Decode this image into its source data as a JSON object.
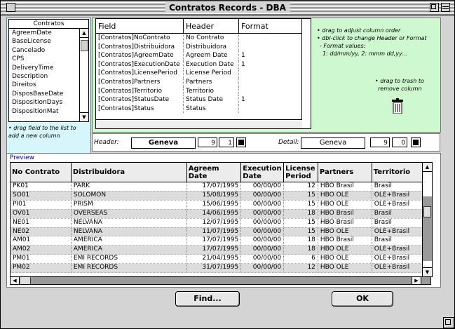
{
  "window": {
    "title": "Contratos Records - DBA"
  },
  "field_list": {
    "header": "Contratos",
    "items": [
      "AgreemDate",
      "BaseLicense",
      "Cancelado",
      "CPS",
      "DeliveryTime",
      "Description",
      "Direitos",
      "DisposBaseDate",
      "DispositionDays",
      "DispositionMat"
    ],
    "hint": "• drag field to the list to add a new column"
  },
  "column_table": {
    "headers": [
      "Field",
      "Header",
      "Format"
    ],
    "rows": [
      [
        "[Contratos]NoContrato",
        "No Contrato",
        ""
      ],
      [
        "[Contratos]Distribuidora",
        "Distribuidora",
        ""
      ],
      [
        "[Contratos]AgreemDate",
        "Agreem Date",
        "1"
      ],
      [
        "[Contratos]ExecutionDate",
        "Execution Date",
        "1"
      ],
      [
        "[Contratos]LicensePeriod",
        "License Period",
        ""
      ],
      [
        "[Contratos]Partners",
        "Partners",
        ""
      ],
      [
        "[Contratos]Territorio",
        "Territorio",
        ""
      ],
      [
        "[Contratos]StatusDate",
        "Status Date",
        "1"
      ],
      [
        "[Contratos]Status",
        "Status",
        ""
      ]
    ]
  },
  "hints": {
    "line1": "• drag to adjust column order",
    "line2": "• dbl-click to change Header or Format",
    "line3": "- Format values:",
    "line4": "1: dd/mm/yy, 2: mmm dd,yy...",
    "trash1": "• drag to trash to",
    "trash2": "remove column"
  },
  "fonts": {
    "header_label": "Header:",
    "header_font": "Geneva",
    "header_size": "9",
    "header_style": "1",
    "detail_label": "Detail:",
    "detail_font": "Geneva",
    "detail_size": "9",
    "detail_style": "0"
  },
  "preview": {
    "label": "Preview",
    "columns": [
      [
        "No Contrato",
        ""
      ],
      [
        "Distribuidora",
        ""
      ],
      [
        "Agreem Date",
        ""
      ],
      [
        "Execution",
        "Date"
      ],
      [
        "License",
        "Period"
      ],
      [
        "Partners",
        ""
      ],
      [
        "Territorio",
        ""
      ]
    ],
    "rows": [
      [
        "PK01",
        "PARK",
        "17/07/1995",
        "00/00/00",
        "12",
        "HBO Brasil",
        "Brasil"
      ],
      [
        "SO01",
        "SOLOMON",
        "15/08/1995",
        "00/00/00",
        "15",
        "HBO OLE",
        "OLE+Brasil"
      ],
      [
        "PI01",
        "PRISM",
        "15/06/1995",
        "00/00/00",
        "15",
        "HBO OLE",
        "OLE+Brasil"
      ],
      [
        "OV01",
        "OVERSEAS",
        "14/06/1995",
        "00/00/00",
        "18",
        "HBO Brasil",
        "Brasil"
      ],
      [
        "NE01",
        "NELVANA",
        "12/07/1995",
        "00/00/00",
        "15",
        "HBO Brasil",
        "Brasil"
      ],
      [
        "NE02",
        "NELVANA",
        "11/07/1995",
        "00/00/00",
        "15",
        "HBO OLE",
        "OLE+Brasil"
      ],
      [
        "AM01",
        "AMERICA",
        "17/07/1995",
        "00/00/00",
        "18",
        "HBO Brasil",
        "Brasil"
      ],
      [
        "AM02",
        "AMERICA",
        "17/07/1995",
        "00/00/00",
        "18",
        "HBO OLE",
        "OLE+Brasil"
      ],
      [
        "PM01",
        "EMI RECORDS",
        "21/04/1995",
        "00/00/00",
        "6",
        "HBO OLE",
        "OLE+Brasil"
      ],
      [
        "PM02",
        "EMI RECORDS",
        "31/07/1995",
        "00/00/00",
        "12",
        "HBO OLE",
        "OLE+Brasil"
      ]
    ]
  },
  "buttons": {
    "find": "Find...",
    "ok": "OK"
  }
}
